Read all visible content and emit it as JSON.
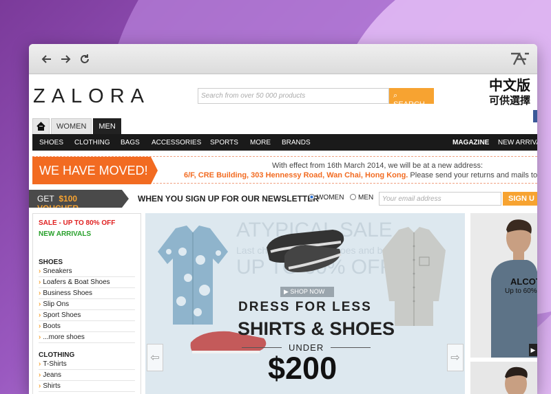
{
  "browser": {
    "back_icon": "arrow-left-icon",
    "forward_icon": "arrow-right-icon",
    "reload_icon": "reload-icon",
    "brand_icon": "browser-logo-icon"
  },
  "header": {
    "logo": "ZALORA",
    "search_placeholder": "Search from over 50 000 products",
    "search_button": "SEARCH",
    "chinese_version": "中文版",
    "chinese_sub": "可供選擇"
  },
  "gender_tabs": [
    "WOMEN",
    "MEN"
  ],
  "active_tab": "MEN",
  "categories": [
    "SHOES",
    "CLOTHING",
    "BAGS",
    "ACCESSORIES",
    "SPORTS",
    "MORE",
    "BRANDS"
  ],
  "categories_right": [
    "MAGAZINE",
    "NEW ARRIVA"
  ],
  "moved_banner": {
    "headline": "WE HAVE MOVED!",
    "line1": "With effect from 16th March 2014, we will be at a new address:",
    "address": "6/F, CRE Building, 303 Hennessy Road, Wan Chai, Hong Kong.",
    "line2_rest": " Please send your returns and mails to this"
  },
  "voucher": {
    "get": "GET",
    "amount": "$100 VOUCHER",
    "newsletter": "WHEN YOU SIGN UP FOR OUR NEWSLETTER",
    "opt_women": "WOMEN",
    "opt_men": "MEN",
    "selected": "WOMEN",
    "email_placeholder": "Your email address",
    "signup": "SIGN U"
  },
  "sidebar": {
    "sale": "SALE - UP TO 80% OFF",
    "new_arrivals": "NEW ARRIVALS",
    "shoes_heading": "SHOES",
    "shoes": [
      "Sneakers",
      "Loafers & Boat Shoes",
      "Business Shoes",
      "Slip Ons",
      "Sport Shoes",
      "Boots",
      "...more shoes"
    ],
    "clothing_heading": "CLOTHING",
    "clothing": [
      "T-Shirts",
      "Jeans",
      "Shirts"
    ]
  },
  "hero": {
    "bg_title": "ATYPICAL SALE",
    "bg_sub": "Last chance ... shirts, shoes and basics",
    "bg_pct": "UP TO 60% OFF",
    "shop_now": "SHOP NOW",
    "dress": "DRESS FOR LESS",
    "shirts_shoes": "SHIRTS & SHOES",
    "under": "UNDER",
    "price": "$200"
  },
  "promo": {
    "brand": "ALCOT",
    "pct": "Up to 60%"
  },
  "colors": {
    "orange": "#f7a331",
    "moved_orange": "#f26b21",
    "sale_red": "#e02020",
    "new_green": "#27a02a",
    "nav_black": "#1a1a1a"
  }
}
